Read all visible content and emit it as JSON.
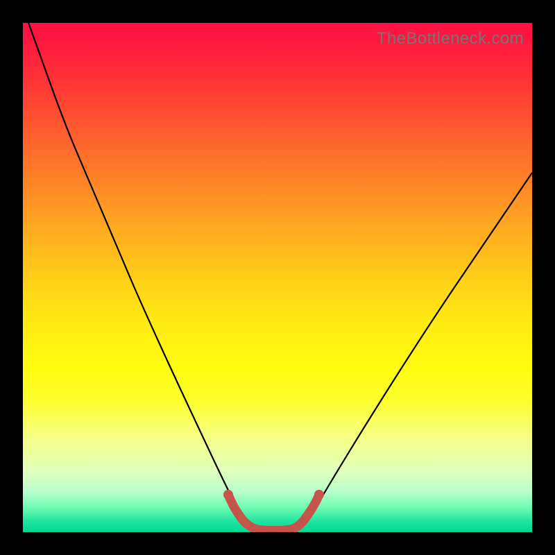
{
  "watermark": "TheBottleneck.com",
  "chart_data": {
    "type": "line",
    "title": "",
    "xlabel": "",
    "ylabel": "",
    "xlim": [
      0,
      100
    ],
    "ylim": [
      0,
      100
    ],
    "series": [
      {
        "name": "bottleneck-curve",
        "x": [
          0,
          4,
          8,
          12,
          16,
          20,
          24,
          28,
          32,
          36,
          40,
          44,
          48,
          52,
          56,
          60,
          64,
          68,
          72,
          76,
          80,
          84,
          88,
          92,
          96,
          100
        ],
        "y": [
          100,
          89,
          78.5,
          68.5,
          58.5,
          49,
          40,
          31.5,
          23,
          15,
          8,
          3,
          0,
          0,
          3,
          8,
          13,
          18,
          23,
          28,
          33,
          38,
          43,
          48,
          53,
          58
        ]
      },
      {
        "name": "optimal-band",
        "x": [
          40,
          42,
          44,
          46,
          48,
          50,
          52,
          54,
          56,
          58
        ],
        "y": [
          8,
          4.5,
          2,
          0.8,
          0.3,
          0.2,
          0.6,
          2,
          4.5,
          8
        ]
      }
    ]
  },
  "colors": {
    "curve": "#000000",
    "band": "#c5554b",
    "background_top": "#ff1244",
    "background_bottom": "#02d890",
    "frame": "#000000"
  }
}
